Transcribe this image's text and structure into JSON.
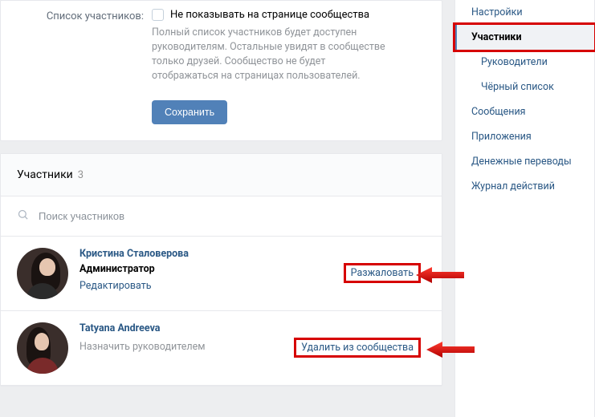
{
  "settings": {
    "row_label": "Список участников:",
    "checkbox_label": "Не показывать на странице сообщества",
    "hint": "Полный список участников будет доступен руководителям. Остальные увидят в сообществе только друзей. Сообщество не будет отображаться на страницах пользователей.",
    "save_label": "Сохранить"
  },
  "members_block": {
    "title": "Участники",
    "count": "3",
    "search_placeholder": "Поиск участников"
  },
  "members": [
    {
      "name": "Кристина Сталоверова",
      "role": "Администратор",
      "secondary_action": "Редактировать",
      "right_action": "Разжаловать"
    },
    {
      "name": "Tatyana Andreeva",
      "role": "",
      "secondary_action": "Назначить руководителем",
      "right_action": "Удалить из сообщества"
    }
  ],
  "sidebar": {
    "items": [
      {
        "label": "Настройки",
        "active": false,
        "child": false
      },
      {
        "label": "Участники",
        "active": true,
        "child": false
      },
      {
        "label": "Руководители",
        "active": false,
        "child": true
      },
      {
        "label": "Чёрный список",
        "active": false,
        "child": true
      },
      {
        "label": "Сообщения",
        "active": false,
        "child": false
      },
      {
        "label": "Приложения",
        "active": false,
        "child": false
      },
      {
        "label": "Денежные переводы",
        "active": false,
        "child": false
      },
      {
        "label": "Журнал действий",
        "active": false,
        "child": false
      }
    ]
  }
}
